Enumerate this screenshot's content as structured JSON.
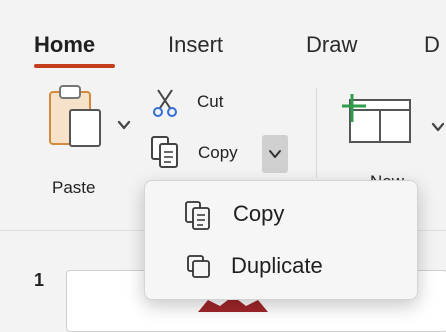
{
  "tabs": [
    {
      "label": "Home",
      "active": true
    },
    {
      "label": "Insert"
    },
    {
      "label": "Draw"
    },
    {
      "label": "D"
    }
  ],
  "ribbon": {
    "paste_label": "Paste",
    "cut_label": "Cut",
    "copy_label": "Copy",
    "new_slide_label": "New"
  },
  "copy_menu": {
    "items": [
      {
        "label": "Copy",
        "icon": "copy-icon"
      },
      {
        "label": "Duplicate",
        "icon": "duplicate-icon"
      }
    ]
  },
  "slides": {
    "current_number": "1"
  },
  "colors": {
    "accent_underline": "#c43e1c",
    "new_slide_plus": "#2e9e4c",
    "thumbnail_art": "#a0262a"
  }
}
